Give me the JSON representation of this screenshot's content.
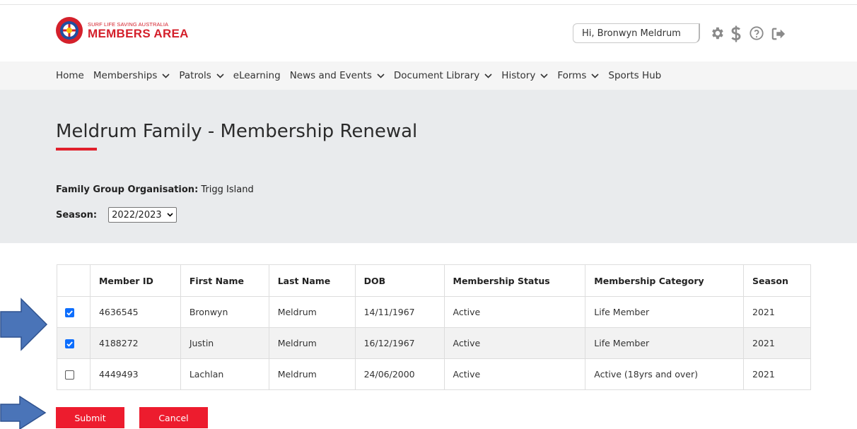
{
  "header": {
    "logo_sub": "SURF LIFE SAVING AUSTRALIA",
    "logo_main": "MEMBERS AREA",
    "greeting": "Hi, Bronwyn Meldrum",
    "icons": [
      "gear-icon",
      "dollar-icon",
      "help-icon",
      "logout-icon"
    ]
  },
  "nav": {
    "items": [
      {
        "label": "Home",
        "dropdown": false
      },
      {
        "label": "Memberships",
        "dropdown": true
      },
      {
        "label": "Patrols",
        "dropdown": true
      },
      {
        "label": "eLearning",
        "dropdown": false
      },
      {
        "label": "News and Events",
        "dropdown": true
      },
      {
        "label": "Document Library",
        "dropdown": true
      },
      {
        "label": "History",
        "dropdown": true
      },
      {
        "label": "Forms",
        "dropdown": true
      },
      {
        "label": "Sports Hub",
        "dropdown": false
      }
    ]
  },
  "page": {
    "title": "Meldrum Family - Membership Renewal",
    "org_label": "Family Group Organisation:",
    "org_value": "Trigg Island",
    "season_label": "Season:",
    "season_value": "2022/2023"
  },
  "table": {
    "headers": [
      "",
      "Member ID",
      "First Name",
      "Last Name",
      "DOB",
      "Membership Status",
      "Membership Category",
      "Season"
    ],
    "rows": [
      {
        "checked": true,
        "member_id": "4636545",
        "first": "Bronwyn",
        "last": "Meldrum",
        "dob": "14/11/1967",
        "status": "Active",
        "category": "Life Member",
        "season": "2021"
      },
      {
        "checked": true,
        "member_id": "4188272",
        "first": "Justin",
        "last": "Meldrum",
        "dob": "16/12/1967",
        "status": "Active",
        "category": "Life Member",
        "season": "2021"
      },
      {
        "checked": false,
        "member_id": "4449493",
        "first": "Lachlan",
        "last": "Meldrum",
        "dob": "24/06/2000",
        "status": "Active",
        "category": "Active (18yrs and over)",
        "season": "2021"
      }
    ]
  },
  "actions": {
    "submit": "Submit",
    "cancel": "Cancel"
  },
  "colors": {
    "accent": "#ed1c2e",
    "arrow": "#4a74b8",
    "hero_bg": "#e9ebed"
  }
}
